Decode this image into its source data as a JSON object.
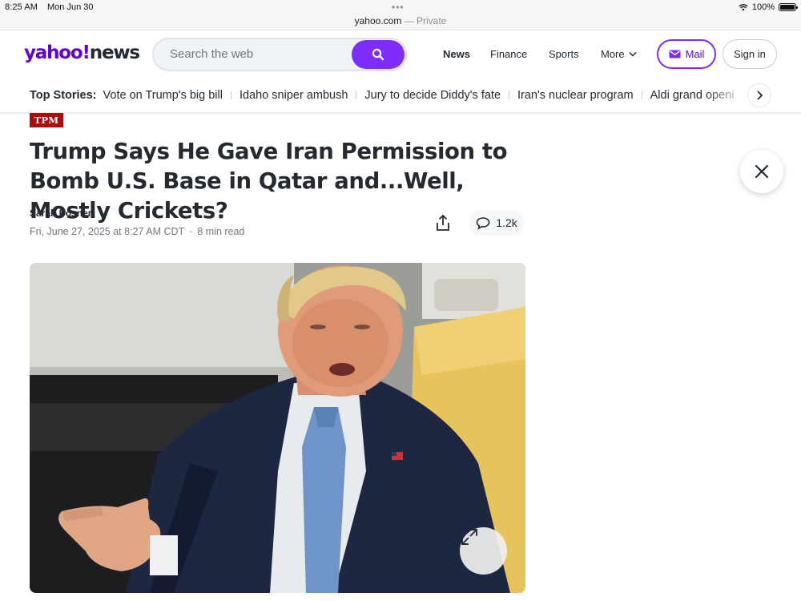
{
  "status_bar": {
    "time": "8:25 AM",
    "date": "Mon Jun 30",
    "battery": "100%",
    "url": "yahoo.com",
    "url_suffix": "— Private"
  },
  "header": {
    "logo_brand": "yahoo!",
    "logo_section": "news",
    "search_placeholder": "Search the web",
    "nav": [
      "News",
      "Finance",
      "Sports",
      "More"
    ],
    "mail_label": "Mail",
    "signin_label": "Sign in",
    "brand_color": "#6001d2",
    "accent_color": "#7d2eff"
  },
  "top_stories": {
    "label": "Top Stories:",
    "items": [
      "Vote on Trump's big bill",
      "Idaho sniper ambush",
      "Jury to decide Diddy's fate",
      "Iran's nuclear program",
      "Aldi grand openi"
    ]
  },
  "article": {
    "source_badge": "TPM",
    "source_color": "#a80d0d",
    "headline": "Trump Says He Gave Iran Permission to Bomb U.S. Base in Qatar and...Well, Mostly Crickets?",
    "author": "Sarah Posner",
    "date": "Fri, June 27, 2025 at 8:27 AM CDT",
    "read_time": "8 min read",
    "comment_count": "1.2k"
  },
  "icons": {
    "search": "search-icon",
    "share": "share-icon",
    "comment": "comment-icon",
    "close": "close-icon",
    "expand": "expand-icon",
    "next": "chevron-right-icon",
    "mail": "mail-icon"
  }
}
